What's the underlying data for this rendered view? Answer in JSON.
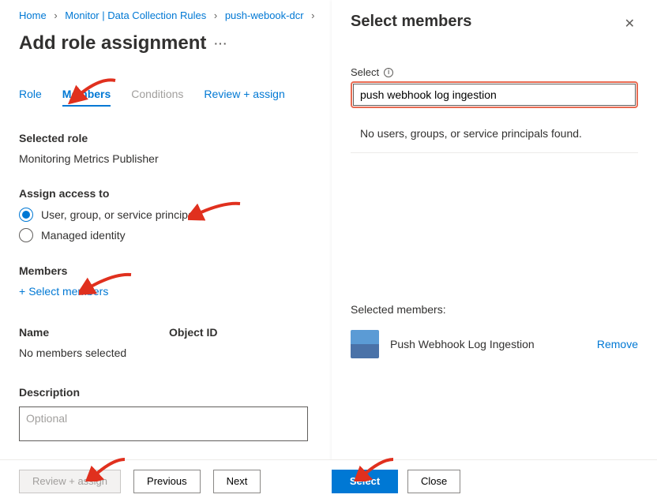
{
  "breadcrumb": {
    "home": "Home",
    "monitor": "Monitor | Data Collection Rules",
    "dcr": "push-webook-dcr"
  },
  "page": {
    "title": "Add role assignment"
  },
  "tabs": {
    "role": "Role",
    "members": "Members",
    "conditions": "Conditions",
    "review": "Review + assign"
  },
  "selected_role": {
    "label": "Selected role",
    "value": "Monitoring Metrics Publisher"
  },
  "assign_access": {
    "label": "Assign access to",
    "options": {
      "principal": "User, group, or service principal",
      "identity": "Managed identity"
    }
  },
  "members": {
    "label": "Members",
    "select_link": "Select members",
    "col_name": "Name",
    "col_object": "Object ID",
    "empty": "No members selected"
  },
  "description": {
    "label": "Description",
    "placeholder": "Optional"
  },
  "footer": {
    "review": "Review + assign",
    "previous": "Previous",
    "next": "Next",
    "select": "Select",
    "close": "Close"
  },
  "panel": {
    "title": "Select members",
    "field_label": "Select",
    "search_value": "push webhook log ingestion",
    "no_results": "No users, groups, or service principals found.",
    "selected_label": "Selected members:",
    "member_name": "Push Webhook Log Ingestion",
    "remove": "Remove"
  }
}
